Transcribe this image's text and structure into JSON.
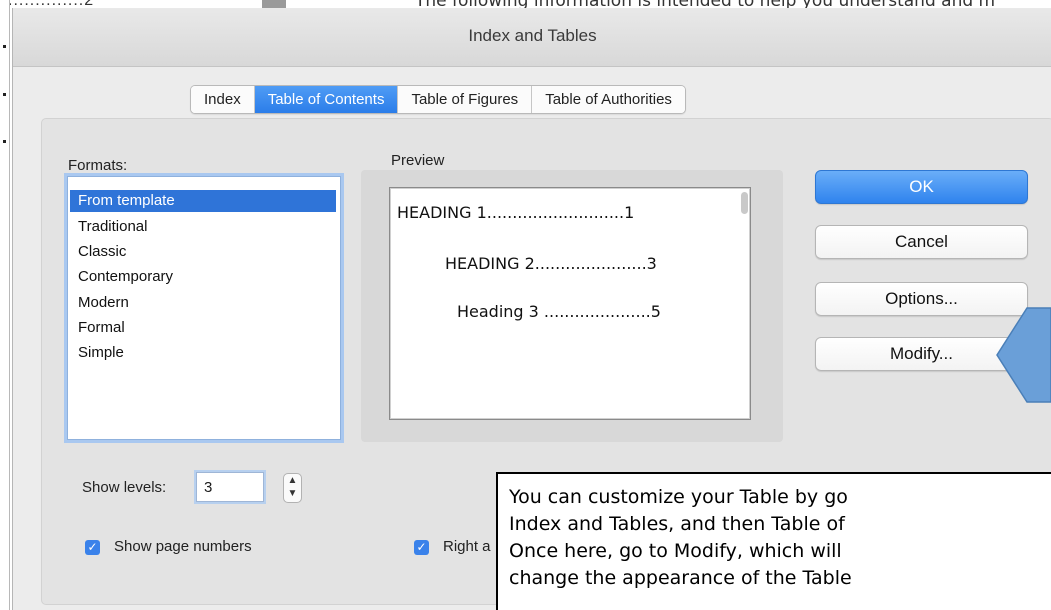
{
  "background_doc": {
    "dots": "..............2",
    "text": "The following information is intended to help you understand and m"
  },
  "dialog": {
    "title": "Index and Tables",
    "tabs": [
      {
        "label": "Index",
        "active": false
      },
      {
        "label": "Table of Contents",
        "active": true
      },
      {
        "label": "Table of Figures",
        "active": false
      },
      {
        "label": "Table of Authorities",
        "active": false
      }
    ],
    "formats": {
      "label": "Formats:",
      "items": [
        "From template",
        "Traditional",
        "Classic",
        "Contemporary",
        "Modern",
        "Formal",
        "Simple"
      ],
      "selected": "From template"
    },
    "preview": {
      "label": "Preview",
      "lines": [
        {
          "text": "HEADING 1",
          "leader": "...........................",
          "page": "1"
        },
        {
          "text": "HEADING 2",
          "leader": "......................",
          "page": "3"
        },
        {
          "text": "Heading 3",
          "leader": " .....................",
          "page": "5"
        }
      ]
    },
    "buttons": {
      "ok": "OK",
      "cancel": "Cancel",
      "options": "Options...",
      "modify": "Modify..."
    },
    "show_levels": {
      "label": "Show levels:",
      "value": "3"
    },
    "show_page_numbers": {
      "label": "Show page numbers",
      "checked": true
    },
    "right_align": {
      "label": "Right a",
      "checked": true
    }
  },
  "callout": {
    "line1": "You can customize your Table by go",
    "line2": "Index and Tables, and then Table of",
    "line3": "Once here, go to Modify, which will",
    "line4": "change the appearance of the Table"
  },
  "colors": {
    "accent": "#2f74d8",
    "primary_button": "#3b8cf2",
    "callout_arrow": "#6a9fd8"
  }
}
